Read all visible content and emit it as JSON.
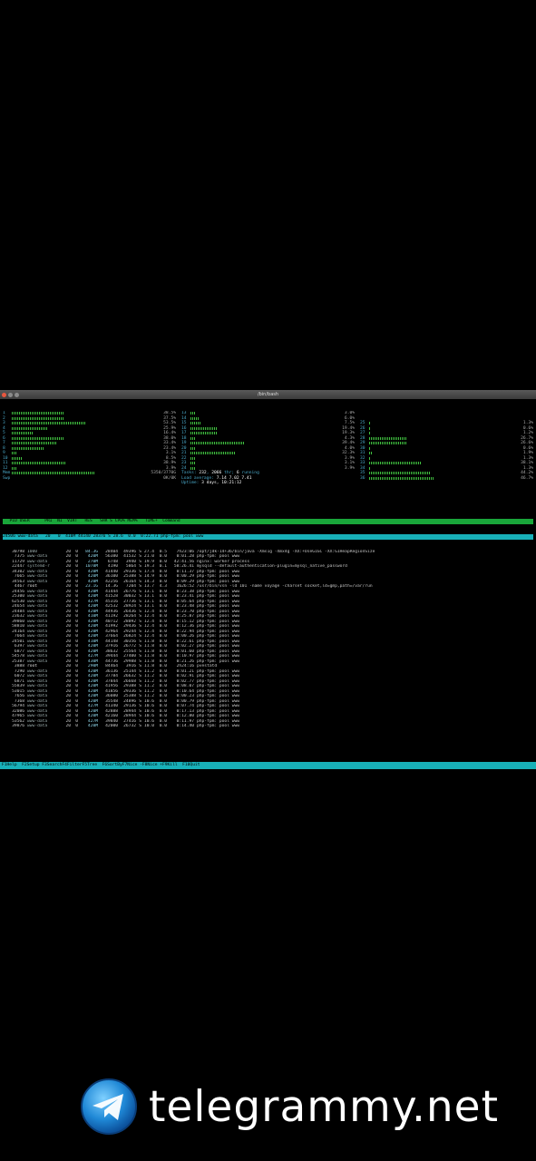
{
  "window": {
    "title": "/bin/bash"
  },
  "cpu_left": [
    {
      "n": "1",
      "pct": "38.5%",
      "f": 0.38
    },
    {
      "n": "2",
      "pct": "37.5%",
      "f": 0.37
    },
    {
      "n": "3",
      "pct": "53.5%",
      "f": 0.53
    },
    {
      "n": "4",
      "pct": "25.9%",
      "f": 0.26
    },
    {
      "n": "5",
      "pct": "16.4%",
      "f": 0.16
    },
    {
      "n": "6",
      "pct": "38.0%",
      "f": 0.38
    },
    {
      "n": "7",
      "pct": "33.4%",
      "f": 0.33
    },
    {
      "n": "8",
      "pct": "23.4%",
      "f": 0.23
    },
    {
      "n": "9",
      "pct": "3.1%",
      "f": 0.03
    },
    {
      "n": "10",
      "pct": "8.5%",
      "f": 0.08
    },
    {
      "n": "11",
      "pct": "38.9%",
      "f": 0.39
    },
    {
      "n": "12",
      "pct": "3.9%",
      "f": 0.04
    }
  ],
  "cpu_mid": [
    {
      "n": "13",
      "pct": "3.0%",
      "f": 0.03
    },
    {
      "n": "14",
      "pct": "6.0%",
      "f": 0.06
    },
    {
      "n": "15",
      "pct": "7.5%",
      "f": 0.07
    },
    {
      "n": "16",
      "pct": "19.4%",
      "f": 0.19
    },
    {
      "n": "17",
      "pct": "19.3%",
      "f": 0.19
    },
    {
      "n": "18",
      "pct": "4.3%",
      "f": 0.04
    },
    {
      "n": "19",
      "pct": "39.4%",
      "f": 0.39
    },
    {
      "n": "20",
      "pct": "4.0%",
      "f": 0.04
    },
    {
      "n": "21",
      "pct": "32.3%",
      "f": 0.32
    },
    {
      "n": "22",
      "pct": "3.9%",
      "f": 0.04
    },
    {
      "n": "23",
      "pct": "3.1%",
      "f": 0.03
    },
    {
      "n": "24",
      "pct": "3.9%",
      "f": 0.04
    }
  ],
  "cpu_right": [
    {
      "n": "25",
      "pct": "1.3%",
      "f": 0.01
    },
    {
      "n": "26",
      "pct": "0.6%",
      "f": 0.01
    },
    {
      "n": "27",
      "pct": "1.2%",
      "f": 0.01
    },
    {
      "n": "28",
      "pct": "26.7%",
      "f": 0.27
    },
    {
      "n": "29",
      "pct": "26.6%",
      "f": 0.27
    },
    {
      "n": "30",
      "pct": "0.6%",
      "f": 0.01
    },
    {
      "n": "31",
      "pct": "1.9%",
      "f": 0.02
    },
    {
      "n": "32",
      "pct": "1.3%",
      "f": 0.01
    },
    {
      "n": "33",
      "pct": "38.1%",
      "f": 0.38
    },
    {
      "n": "34",
      "pct": "1.3%",
      "f": 0.01
    },
    {
      "n": "35",
      "pct": "44.2%",
      "f": 0.44
    },
    {
      "n": "36",
      "pct": "46.7%",
      "f": 0.47
    }
  ],
  "mem": {
    "label": "Mem",
    "value": "5350/3770G",
    "f": 0.6
  },
  "swp": {
    "label": "Swp",
    "value": "0K/0K",
    "f": 0.0
  },
  "tasks": {
    "label": "Tasks:",
    "value": "232",
    "thr": "2066",
    "thr_label": "thr;",
    "running": "6",
    "running_label": "running"
  },
  "load": {
    "label": "Load average:",
    "value": "7.14 7.02 7.41"
  },
  "uptime": {
    "label": "Uptime:",
    "value": "3 days, 10:21:12"
  },
  "header": "  PID USER      PRI  NI  VIRT   RES   SHR S CPU% MEM%   TIME+  Command",
  "highlight": "24506 www-data   20   0  410M 44140 28376 S 28.6  0.0  0:22.71 php-fpm: pool www",
  "processes": [
    [
      "30798",
      "1000",
      "20",
      "0",
      "84.3G",
      "28404",
      "49396",
      "S",
      "27.4",
      "0.5",
      "7h23:06",
      "/opt/jdk-14+36/bin/java -Xms1g -Xmx4g -XX:+UseG1GC -XX:G1HeapRegionSize"
    ],
    [
      "7375",
      "www-data",
      "20",
      "0",
      "420M",
      "56380",
      "41532",
      "S",
      "21.0",
      "0.0",
      "0:01.28",
      "php-fpm: pool www"
    ],
    [
      "11729",
      "www-data",
      "20",
      "0",
      "270M",
      "6748",
      "3940",
      "S",
      "19.9",
      "0.0",
      "42:41.56",
      "nginx: worker process"
    ],
    [
      "22447",
      "systemd-r",
      "20",
      "0",
      "1078M",
      "4190",
      "5864",
      "S",
      "19.3",
      "0.1",
      "58:26.41",
      "mysqld --default-authentication-plugin=mysql_native_password"
    ],
    [
      "34302",
      "www-data",
      "20",
      "0",
      "420M",
      "41440",
      "29336",
      "S",
      "17.4",
      "0.0",
      "0:11.37",
      "php-fpm: pool www"
    ],
    [
      "7665",
      "www-data",
      "20",
      "0",
      "420M",
      "36100",
      "25388",
      "S",
      "14.9",
      "0.0",
      "0:00.29",
      "php-fpm: pool www"
    ],
    [
      "34563",
      "www-data",
      "20",
      "0",
      "420M",
      "42256",
      "26164",
      "S",
      "14.3",
      "0.0",
      "0:09.29",
      "php-fpm: pool www"
    ],
    [
      "4467",
      "root",
      "20",
      "0",
      "23.1G",
      "14.3G",
      "7204",
      "S",
      "13.7",
      "4.3",
      "1626:52",
      "/usr/bin/vsn -ld 101 -name voyage -charset socket,ld=gmp,path=/var/run"
    ],
    [
      "24456",
      "www-data",
      "20",
      "0",
      "420M",
      "41444",
      "26776",
      "S",
      "13.1",
      "0.0",
      "0:23.38",
      "php-fpm: pool www"
    ],
    [
      "25300",
      "www-data",
      "20",
      "0",
      "420M",
      "41528",
      "30032",
      "S",
      "13.1",
      "0.0",
      "0:23.41",
      "php-fpm: pool www"
    ],
    [
      "62530",
      "www-data",
      "20",
      "0",
      "427M",
      "45316",
      "27736",
      "S",
      "13.1",
      "0.0",
      "0:05.64",
      "php-fpm: pool www"
    ],
    [
      "24654",
      "www-data",
      "20",
      "0",
      "420M",
      "42532",
      "28924",
      "S",
      "13.1",
      "0.0",
      "0:23.48",
      "php-fpm: pool www"
    ],
    [
      "24484",
      "www-data",
      "20",
      "0",
      "420M",
      "44936",
      "26436",
      "S",
      "12.4",
      "0.0",
      "0:23.70",
      "php-fpm: pool www"
    ],
    [
      "23632",
      "www-data",
      "20",
      "0",
      "410M",
      "41192",
      "28264",
      "S",
      "12.4",
      "0.0",
      "0:25.87",
      "php-fpm: pool www"
    ],
    [
      "39860",
      "www-data",
      "20",
      "0",
      "420M",
      "40712",
      "28092",
      "S",
      "12.4",
      "0.0",
      "0:15.12",
      "php-fpm: pool www"
    ],
    [
      "58810",
      "www-data",
      "20",
      "0",
      "420M",
      "41992",
      "29436",
      "S",
      "12.4",
      "0.0",
      "0:12.36",
      "php-fpm: pool www"
    ],
    [
      "24164",
      "www-data",
      "20",
      "0",
      "420M",
      "42964",
      "29244",
      "S",
      "12.4",
      "0.0",
      "0:22.94",
      "php-fpm: pool www"
    ],
    [
      "7664",
      "www-data",
      "20",
      "0",
      "420M",
      "37664",
      "26824",
      "S",
      "12.4",
      "0.0",
      "0:00.26",
      "php-fpm: pool www"
    ],
    [
      "24501",
      "www-data",
      "20",
      "0",
      "410M",
      "44148",
      "30356",
      "S",
      "11.8",
      "0.0",
      "0:22.61",
      "php-fpm: pool www"
    ],
    [
      "6397",
      "www-data",
      "20",
      "0",
      "420M",
      "37916",
      "26772",
      "S",
      "11.8",
      "0.0",
      "0:02.27",
      "php-fpm: pool www"
    ],
    [
      "6877",
      "www-data",
      "20",
      "0",
      "420M",
      "38632",
      "25564",
      "S",
      "11.8",
      "0.0",
      "0:01.60",
      "php-fpm: pool www"
    ],
    [
      "54578",
      "www-data",
      "20",
      "0",
      "427M",
      "39444",
      "27400",
      "S",
      "11.8",
      "0.0",
      "0:10.97",
      "php-fpm: pool www"
    ],
    [
      "25387",
      "www-data",
      "20",
      "0",
      "430M",
      "44736",
      "29988",
      "S",
      "11.8",
      "0.0",
      "0:21.26",
      "php-fpm: pool www"
    ],
    [
      "3888",
      "root",
      "20",
      "0",
      "290M",
      "84464",
      "3916",
      "S",
      "11.8",
      "0.0",
      "2h24:16",
      "pvestatd"
    ],
    [
      "7290",
      "www-data",
      "20",
      "0",
      "420M",
      "36136",
      "25144",
      "S",
      "11.2",
      "0.0",
      "0:01.21",
      "php-fpm: pool www"
    ],
    [
      "6072",
      "www-data",
      "20",
      "0",
      "420M",
      "37784",
      "26632",
      "S",
      "11.2",
      "0.0",
      "0:02.91",
      "php-fpm: pool www"
    ],
    [
      "6871",
      "www-data",
      "20",
      "0",
      "420M",
      "37844",
      "26668",
      "S",
      "11.2",
      "0.0",
      "0:02.77",
      "php-fpm: pool www"
    ],
    [
      "55839",
      "www-data",
      "20",
      "0",
      "420M",
      "41956",
      "29388",
      "S",
      "11.2",
      "0.0",
      "0:08.07",
      "php-fpm: pool www"
    ],
    [
      "53015",
      "www-data",
      "20",
      "0",
      "420M",
      "41856",
      "29336",
      "S",
      "11.2",
      "0.0",
      "0:10.64",
      "php-fpm: pool www"
    ],
    [
      "7656",
      "www-data",
      "20",
      "0",
      "420M",
      "36080",
      "25388",
      "S",
      "11.2",
      "0.0",
      "0:00.23",
      "php-fpm: pool www"
    ],
    [
      "7368",
      "www-data",
      "20",
      "0",
      "420M",
      "35548",
      "24896",
      "S",
      "10.6",
      "0.0",
      "0:00.79",
      "php-fpm: pool www"
    ],
    [
      "56794",
      "www-data",
      "20",
      "0",
      "427M",
      "41340",
      "29136",
      "S",
      "10.6",
      "0.0",
      "0:07.74",
      "php-fpm: pool www"
    ],
    [
      "32086",
      "www-data",
      "20",
      "0",
      "420M",
      "42888",
      "28944",
      "S",
      "10.6",
      "0.0",
      "0:17.13",
      "php-fpm: pool www"
    ],
    [
      "47965",
      "www-data",
      "20",
      "0",
      "420M",
      "42160",
      "28944",
      "S",
      "10.6",
      "0.0",
      "0:12.80",
      "php-fpm: pool www"
    ],
    [
      "53562",
      "www-data",
      "20",
      "0",
      "427M",
      "39840",
      "27416",
      "S",
      "10.6",
      "0.0",
      "0:11.97",
      "php-fpm: pool www"
    ],
    [
      "39876",
      "www-data",
      "20",
      "0",
      "420M",
      "42000",
      "26732",
      "S",
      "10.0",
      "0.0",
      "0:14.40",
      "php-fpm: pool www"
    ]
  ],
  "fkeys": "F1Help  F2Setup F3SearchF4FilterF5Tree  F6SortByF7Nice -F8Nice +F9Kill  F10Quit",
  "brand": {
    "text": "telegrammy.net"
  }
}
